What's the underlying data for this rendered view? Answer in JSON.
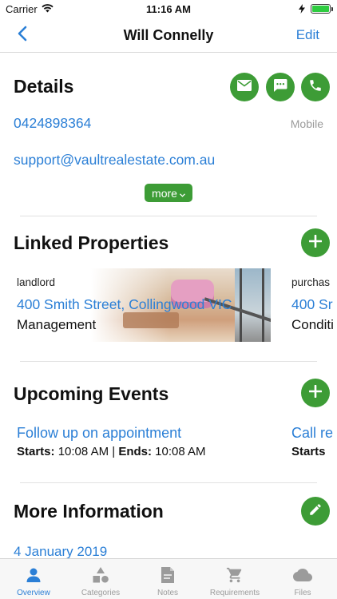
{
  "status_bar": {
    "carrier": "Carrier",
    "time": "11:16 AM",
    "battery_level": 1.0
  },
  "nav": {
    "title": "Will Connelly",
    "edit_label": "Edit"
  },
  "details": {
    "title": "Details",
    "phone": "0424898364",
    "phone_type": "Mobile",
    "email": "support@vaultrealestate.com.au",
    "more_label": "more",
    "actions": [
      "mail-icon",
      "message-icon",
      "phone-icon"
    ]
  },
  "linked_properties": {
    "title": "Linked Properties",
    "items": [
      {
        "role": "landlord",
        "address": "400 Smith Street, Collingwood VIC",
        "type": "Management"
      },
      {
        "role": "purchas",
        "address": "400 Sr",
        "type": "Conditi"
      }
    ]
  },
  "upcoming_events": {
    "title": "Upcoming Events",
    "items": [
      {
        "title": "Follow up on appointment",
        "starts_label": "Starts:",
        "starts": "10:08 AM",
        "separator": "|",
        "ends_label": "Ends:",
        "ends": "10:08 AM"
      },
      {
        "title": "Call re",
        "starts_label": "Starts"
      }
    ]
  },
  "more_information": {
    "title": "More Information",
    "date": "4 January 2019"
  },
  "tabs": [
    {
      "label": "Overview",
      "icon": "person-icon",
      "active": true
    },
    {
      "label": "Categories",
      "icon": "shapes-icon",
      "active": false
    },
    {
      "label": "Notes",
      "icon": "note-icon",
      "active": false
    },
    {
      "label": "Requirements",
      "icon": "cart-icon",
      "active": false
    },
    {
      "label": "Files",
      "icon": "cloud-icon",
      "active": false
    }
  ],
  "colors": {
    "accent": "#2b7fd6",
    "action_green": "#3d9c36",
    "tab_inactive": "#9b9b9b"
  }
}
